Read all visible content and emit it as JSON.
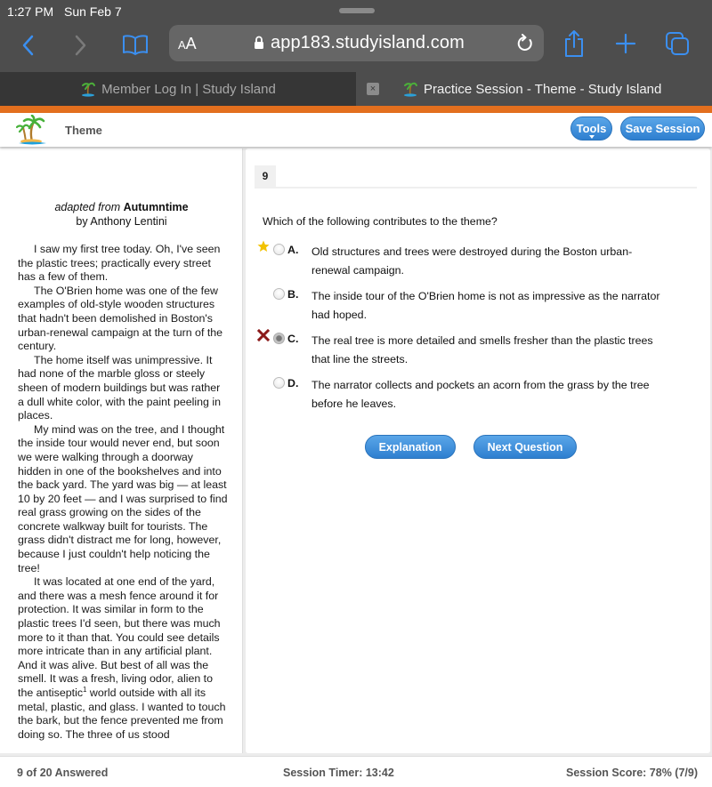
{
  "status_bar": {
    "time": "1:27 PM",
    "date": "Sun Feb 7"
  },
  "browser": {
    "text_size_label_small": "A",
    "text_size_label_large": "A",
    "url": "app183.studyisland.com",
    "icons": [
      "back-icon",
      "forward-icon",
      "bookmarks-icon",
      "lock-icon",
      "reload-icon",
      "share-icon",
      "new-tab-icon",
      "tabs-icon"
    ]
  },
  "tabs": [
    {
      "title": "Member Log In | Study Island",
      "active": false
    },
    {
      "title": "Practice Session - Theme - Study Island",
      "active": true,
      "close_label": "×"
    }
  ],
  "colors": {
    "accent_orange": "#e36f1e",
    "button_blue": "#3a8bd8",
    "star": "#f2c200",
    "wrong_x": "#8b1a1a"
  },
  "header": {
    "title": "Theme",
    "tools_label": "Tools",
    "save_label": "Save Session"
  },
  "passage": {
    "adapted_from": "adapted from",
    "title": "Autumntime",
    "author": "by Anthony Lentini",
    "paragraphs": [
      "I saw my first tree today. Oh, I've seen the plastic trees; practically every street has a few of them.",
      "The O'Brien home was one of the few examples of old-style wooden structures that hadn't been demolished in Boston's urban-renewal campaign at the turn of the century.",
      "The home itself was unimpressive. It had none of the marble gloss or steely sheen of modern buildings but was rather a dull white color, with the paint peeling in places.",
      "My mind was on the tree, and I thought the inside tour would never end, but soon we were walking through a doorway hidden in one of the bookshelves and into the back yard. The yard was big — at least 10 by 20 feet — and I was surprised to find real grass growing on the sides of the concrete walkway built for tourists. The grass didn't distract me for long, however, because I just couldn't help noticing the tree!"
    ],
    "last_paragraph_before_footnote": "It was located at one end of the yard, and there was a mesh fence around it for protection. It was similar in form to the plastic trees I'd seen, but there was much more to it than that. You could see details more intricate than in any artificial plant. And it was alive. But best of all was the smell. It was a fresh, living odor, alien to the antiseptic",
    "footnote_mark": "1",
    "last_paragraph_after_footnote": " world outside with all its metal, plastic, and glass. I wanted to touch the bark, but the fence prevented me from doing so. The three of us stood"
  },
  "question": {
    "number": "9",
    "prompt": "Which of the following contributes to the theme?",
    "choices": [
      {
        "letter": "A.",
        "text": "Old structures and trees were destroyed during the Boston urban-renewal campaign.",
        "marker": "star-icon",
        "selected": false
      },
      {
        "letter": "B.",
        "text": "The inside tour of the O'Brien home is not as impressive as the narrator had hoped.",
        "marker": "",
        "selected": false
      },
      {
        "letter": "C.",
        "text": "The real tree is more detailed and smells fresher than the plastic trees that line the streets.",
        "marker": "x-icon",
        "selected": true
      },
      {
        "letter": "D.",
        "text": "The narrator collects and pockets an acorn from the grass by the tree before he leaves.",
        "marker": "",
        "selected": false
      }
    ],
    "explanation_label": "Explanation",
    "next_label": "Next Question"
  },
  "footer": {
    "answered": "9 of 20 Answered",
    "timer": "Session Timer: 13:42",
    "score": "Session Score: 78% (7/9)"
  }
}
